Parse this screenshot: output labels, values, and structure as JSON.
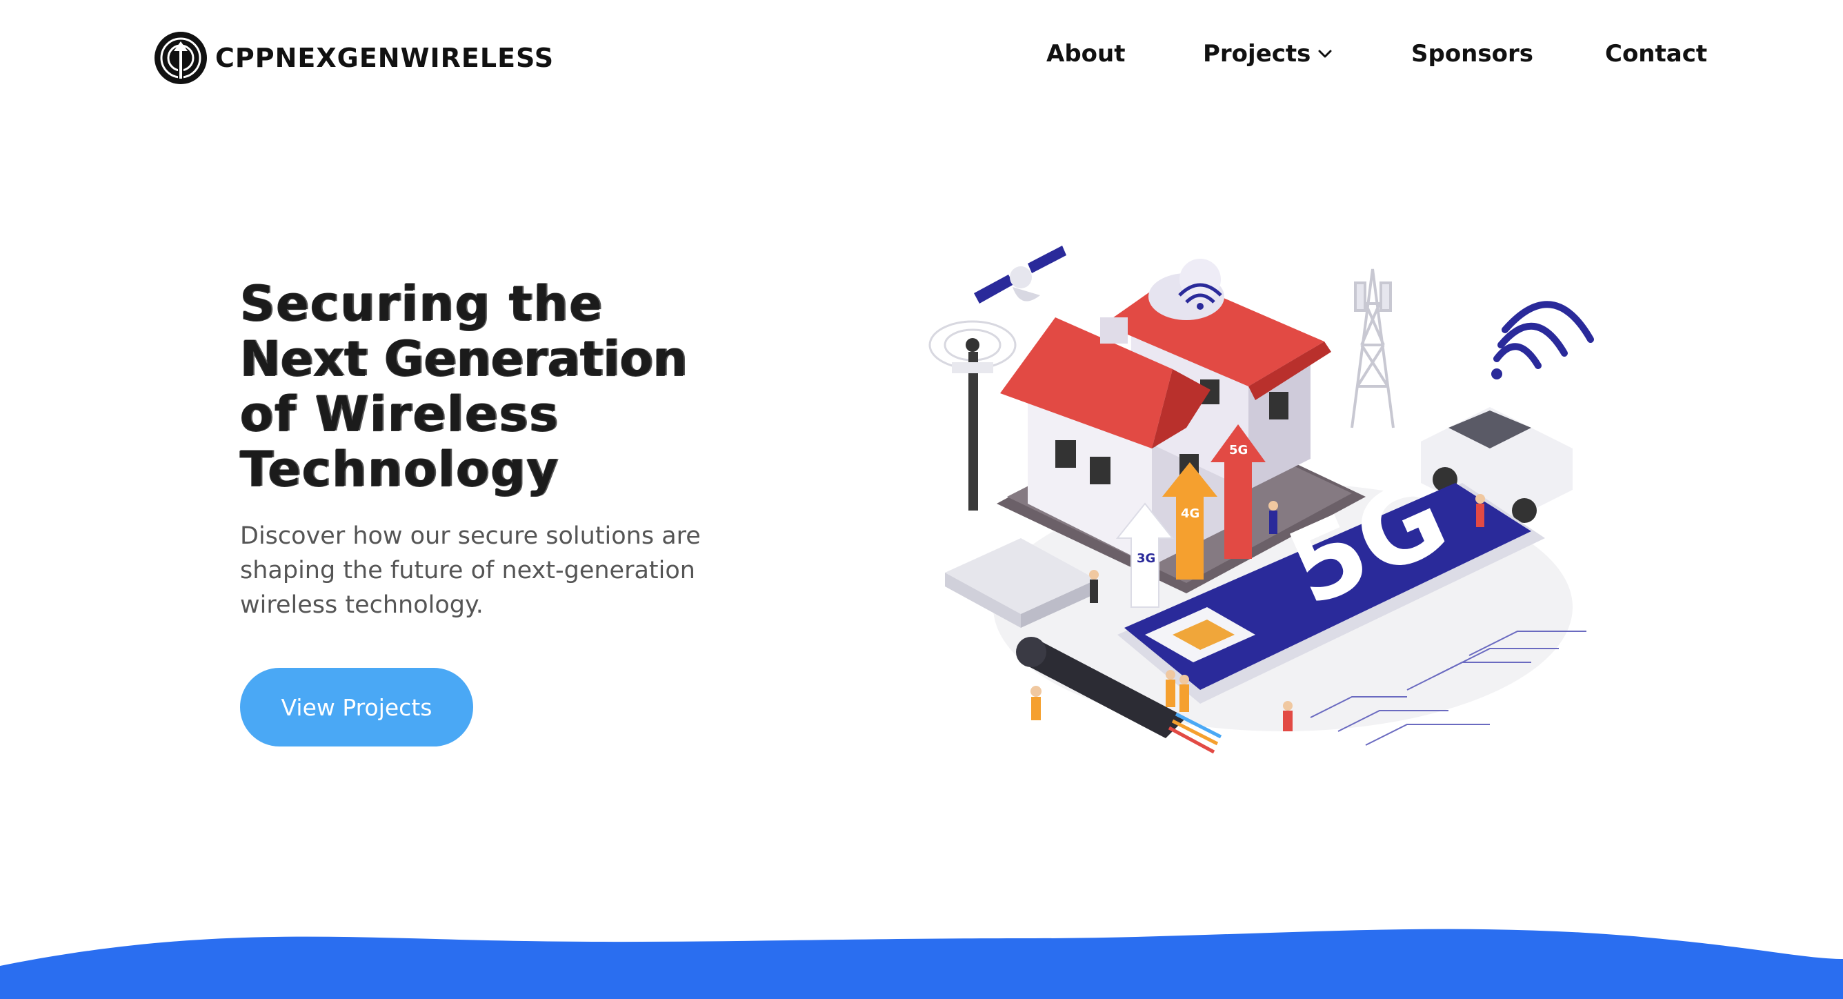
{
  "brand": {
    "name": "CPPNEXGENWIRELESS",
    "logo_icon": "wireless-antenna-icon"
  },
  "nav": {
    "about": "About",
    "projects": "Projects",
    "sponsors": "Sponsors",
    "contact": "Contact"
  },
  "hero": {
    "title_lines": [
      "Securing the",
      "Next Generation",
      "of Wireless",
      "Technology"
    ],
    "description": "Discover how our secure solutions are shaping the future of next-generation wireless technology.",
    "cta": "View Projects"
  },
  "illustration": {
    "big_label": "5G",
    "arrow_labels": [
      "3G",
      "4G",
      "5G"
    ]
  },
  "colors": {
    "accent_button": "#4aa8f5",
    "wave": "#2a6ef0",
    "phone": "#2a2a9a",
    "roof": "#e24a44"
  }
}
